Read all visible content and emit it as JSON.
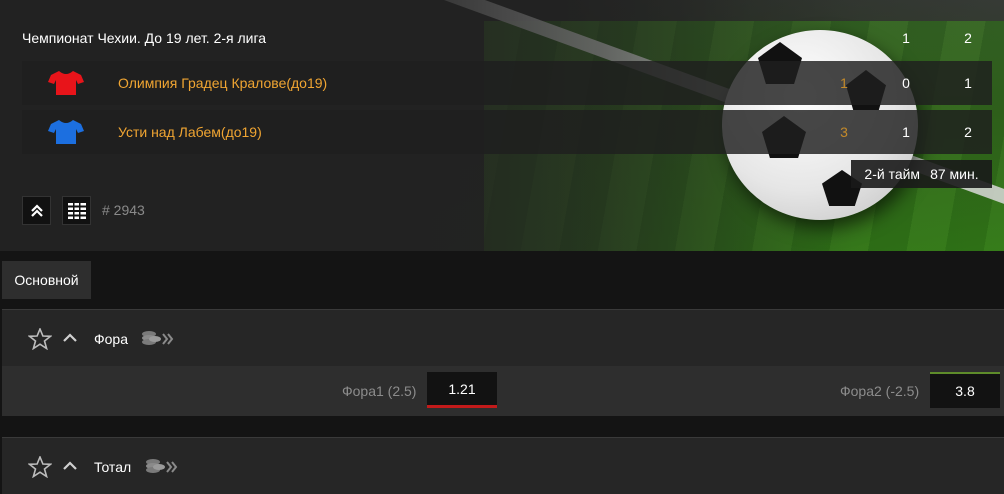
{
  "match": {
    "league": "Чемпионат Чехии. До 19 лет. 2-я лига",
    "period_headers": [
      "1",
      "2"
    ],
    "teams": [
      {
        "name": "Олимпия Градец Кралове(до19)",
        "goals": "1",
        "p1": "0",
        "p2": "1",
        "shirt_color": "#e8141a",
        "shirt_icon": "red-shirt-icon"
      },
      {
        "name": "Усти над Лабем(до19)",
        "goals": "3",
        "p1": "1",
        "p2": "2",
        "shirt_color": "#1c6fe0",
        "shirt_icon": "blue-shirt-icon"
      }
    ],
    "status": {
      "period": "2-й тайм",
      "minute": "87 мин."
    },
    "game_id": "# 2943"
  },
  "tabs": [
    {
      "label": "Основной"
    }
  ],
  "sections": [
    {
      "title": "Фора",
      "odds": [
        {
          "label": "Фора1 (2.5)",
          "value": "1.21",
          "trend": "down"
        },
        {
          "label": "Фора2 (-2.5)",
          "value": "3.8",
          "trend": "up"
        }
      ]
    },
    {
      "title": "Тотал"
    }
  ],
  "colors": {
    "accent": "#f0a532",
    "background": "#141414",
    "trend_down": "#c21a1a",
    "trend_up": "#5e8c2a"
  }
}
